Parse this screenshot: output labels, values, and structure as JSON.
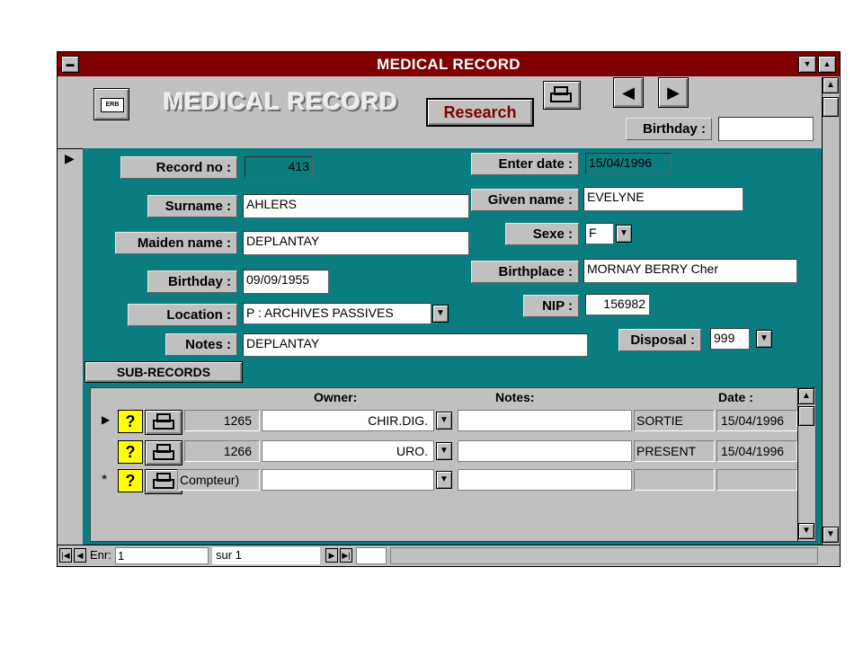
{
  "window": {
    "title": "MEDICAL RECORD"
  },
  "header": {
    "title": "MEDICAL RECORD",
    "research_label": "Research",
    "birthday_label": "Birthday :",
    "birthday_value": ""
  },
  "form": {
    "record_no_label": "Record no :",
    "record_no": "413",
    "enter_date_label": "Enter date :",
    "enter_date": "15/04/1996",
    "surname_label": "Surname :",
    "surname": "AHLERS",
    "given_name_label": "Given name :",
    "given_name": "EVELYNE",
    "maiden_name_label": "Maiden name :",
    "maiden_name": "DEPLANTAY",
    "sexe_label": "Sexe :",
    "sexe": "F",
    "birthday_label": "Birthday :",
    "birthday": "09/09/1955",
    "birthplace_label": "Birthplace :",
    "birthplace": "MORNAY BERRY Cher",
    "location_label": "Location :",
    "location": "P : ARCHIVES PASSIVES",
    "nip_label": "NIP :",
    "nip": "156982",
    "notes_label": "Notes :",
    "notes": "DEPLANTAY",
    "disposal_label": "Disposal :",
    "disposal": "999"
  },
  "subrecords": {
    "tab_label": "SUB-RECORDS",
    "columns": {
      "owner": "Owner:",
      "notes": "Notes:",
      "date": "Date :"
    },
    "rows": [
      {
        "counter": "1265",
        "owner": "CHIR.DIG.",
        "notes": "",
        "status": "SORTIE",
        "date": "15/04/1996"
      },
      {
        "counter": "1266",
        "owner": "URO.",
        "notes": "",
        "status": "PRESENT",
        "date": "15/04/1996"
      },
      {
        "counter": "Compteur)",
        "owner": "",
        "notes": "",
        "status": "",
        "date": ""
      }
    ],
    "new_row_marker": "*"
  },
  "navigation": {
    "record_label": "Enr:",
    "record_value": "1",
    "total_label": "sur 1"
  }
}
